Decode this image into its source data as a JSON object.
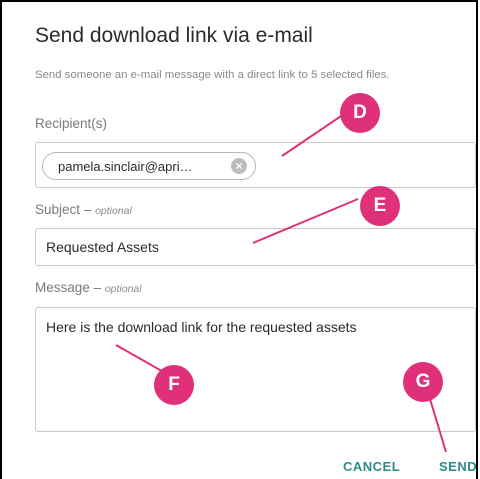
{
  "dialog": {
    "title": "Send download link via e-mail",
    "description": "Send someone an e-mail message with a direct link to 5 selected files."
  },
  "recipients": {
    "label": "Recipient(s)",
    "chip_text": "pamela.sinclair@apri…",
    "chip_remove_icon": "close-circle-icon"
  },
  "subject": {
    "label": "Subject –",
    "optional": "optional",
    "value": "Requested Assets"
  },
  "message": {
    "label": "Message –",
    "optional": "optional",
    "value": "Here is the download link for the requested assets"
  },
  "actions": {
    "cancel_label": "CANCEL",
    "send_label": "SEND"
  },
  "callouts": {
    "d": "D",
    "e": "E",
    "f": "F",
    "g": "G"
  },
  "colors": {
    "accent": "#2d8a8c",
    "callout": "#e0307a",
    "border": "#c9c9c9"
  }
}
